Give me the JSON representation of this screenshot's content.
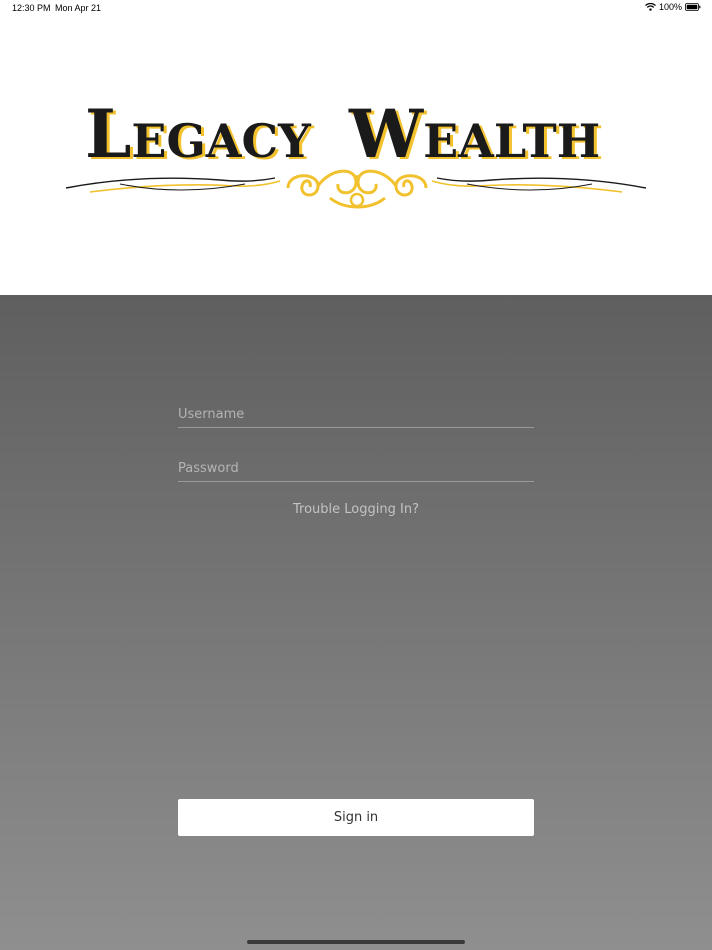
{
  "status_bar": {
    "time": "12:30 PM",
    "date": "Mon Apr 21",
    "battery": "100%"
  },
  "logo": {
    "text_part1": "Legacy",
    "text_part2": "Wealth",
    "gold": "#f2c12e",
    "dark": "#1a1a1a"
  },
  "login": {
    "username_placeholder": "Username",
    "password_placeholder": "Password",
    "trouble_label": "Trouble Logging In?",
    "signin_label": "Sign in"
  }
}
